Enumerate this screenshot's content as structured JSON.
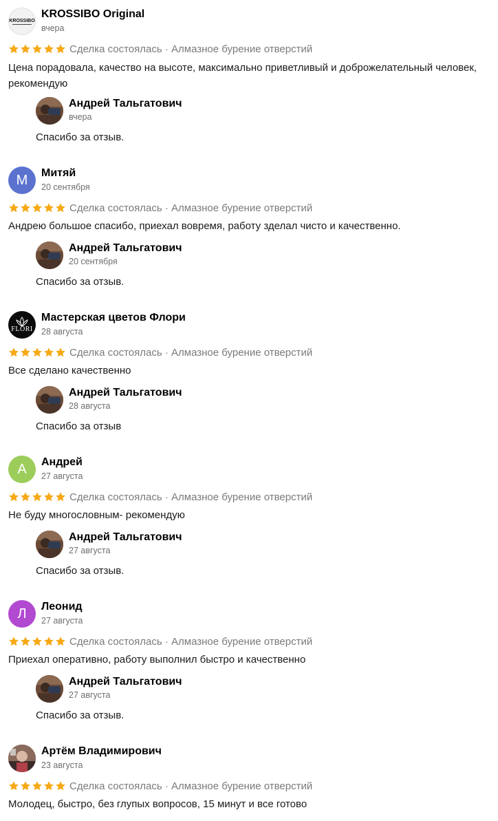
{
  "colors": {
    "star": "#f6a915",
    "text_secondary": "#7a7a7a",
    "avatar_m": "#5b72cf",
    "avatar_a": "#9ccd5a",
    "avatar_l": "#b249d1"
  },
  "reviews": [
    {
      "author": "KROSSIBO Original",
      "date": "вчера",
      "avatar_type": "logo",
      "avatar_logo_text": "KROSSIBO",
      "rating": 5,
      "deal_text": "Сделка состоялась · Алмазное бурение отверстий",
      "text": "Цена порадовала, качество на высоте, максимально приветливый и доброжелательный человек, рекомендую",
      "reply": {
        "author": "Андрей Тальгатович",
        "date": "вчера",
        "text": "Спасибо за отзыв."
      }
    },
    {
      "author": "Митяй",
      "date": "20 сентября",
      "avatar_type": "letter",
      "avatar_letter": "М",
      "avatar_color": "#5b72cf",
      "rating": 5,
      "deal_text": "Сделка состоялась · Алмазное бурение отверстий",
      "text": "Андрею большое спасибо, приехал вовремя, работу зделал чисто и качественно.",
      "reply": {
        "author": "Андрей Тальгатович",
        "date": "20 сентября",
        "text": "Спасибо за отзыв."
      }
    },
    {
      "author": "Мастерская цветов Флори",
      "date": "28 августа",
      "avatar_type": "logo",
      "avatar_logo_text": "FLORI",
      "rating": 5,
      "deal_text": "Сделка состоялась · Алмазное бурение отверстий",
      "text": "Все сделано качественно",
      "reply": {
        "author": "Андрей Тальгатович",
        "date": "28 августа",
        "text": "Спасибо за отзыв"
      }
    },
    {
      "author": "Андрей",
      "date": "27 августа",
      "avatar_type": "letter",
      "avatar_letter": "А",
      "avatar_color": "#9ccd5a",
      "rating": 5,
      "deal_text": "Сделка состоялась · Алмазное бурение отверстий",
      "text": "Не буду многословным- рекомендую",
      "reply": {
        "author": "Андрей Тальгатович",
        "date": "27 августа",
        "text": "Спасибо за отзыв."
      }
    },
    {
      "author": "Леонид",
      "date": "27 августа",
      "avatar_type": "letter",
      "avatar_letter": "Л",
      "avatar_color": "#b249d1",
      "rating": 5,
      "deal_text": "Сделка состоялась · Алмазное бурение отверстий",
      "text": "Приехал оперативно, работу выполнил быстро и качественно",
      "reply": {
        "author": "Андрей Тальгатович",
        "date": "27 августа",
        "text": "Спасибо за отзыв."
      }
    },
    {
      "author": "Артём Владимирович",
      "date": "23 августа",
      "avatar_type": "photo",
      "rating": 5,
      "deal_text": "Сделка состоялась · Алмазное бурение отверстий",
      "text": "Молодец, быстро, без глупых вопросов, 15 минут и все готово"
    }
  ]
}
